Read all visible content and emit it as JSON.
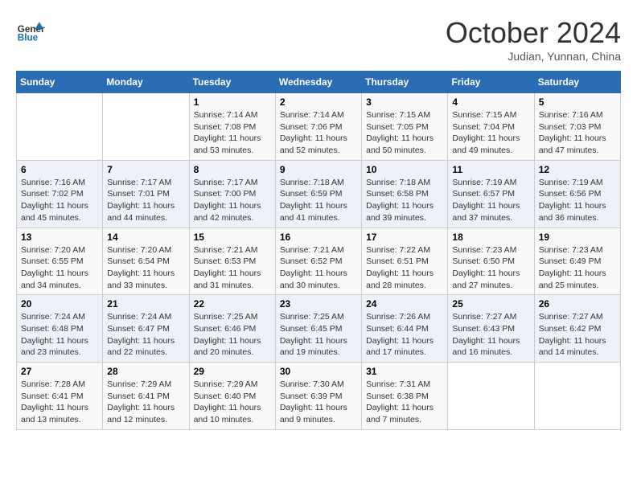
{
  "header": {
    "logo_general": "General",
    "logo_blue": "Blue",
    "month_title": "October 2024",
    "subtitle": "Judian, Yunnan, China"
  },
  "days_of_week": [
    "Sunday",
    "Monday",
    "Tuesday",
    "Wednesday",
    "Thursday",
    "Friday",
    "Saturday"
  ],
  "weeks": [
    [
      {
        "day": "",
        "sunrise": "",
        "sunset": "",
        "daylight": ""
      },
      {
        "day": "",
        "sunrise": "",
        "sunset": "",
        "daylight": ""
      },
      {
        "day": "1",
        "sunrise": "Sunrise: 7:14 AM",
        "sunset": "Sunset: 7:08 PM",
        "daylight": "Daylight: 11 hours and 53 minutes."
      },
      {
        "day": "2",
        "sunrise": "Sunrise: 7:14 AM",
        "sunset": "Sunset: 7:06 PM",
        "daylight": "Daylight: 11 hours and 52 minutes."
      },
      {
        "day": "3",
        "sunrise": "Sunrise: 7:15 AM",
        "sunset": "Sunset: 7:05 PM",
        "daylight": "Daylight: 11 hours and 50 minutes."
      },
      {
        "day": "4",
        "sunrise": "Sunrise: 7:15 AM",
        "sunset": "Sunset: 7:04 PM",
        "daylight": "Daylight: 11 hours and 49 minutes."
      },
      {
        "day": "5",
        "sunrise": "Sunrise: 7:16 AM",
        "sunset": "Sunset: 7:03 PM",
        "daylight": "Daylight: 11 hours and 47 minutes."
      }
    ],
    [
      {
        "day": "6",
        "sunrise": "Sunrise: 7:16 AM",
        "sunset": "Sunset: 7:02 PM",
        "daylight": "Daylight: 11 hours and 45 minutes."
      },
      {
        "day": "7",
        "sunrise": "Sunrise: 7:17 AM",
        "sunset": "Sunset: 7:01 PM",
        "daylight": "Daylight: 11 hours and 44 minutes."
      },
      {
        "day": "8",
        "sunrise": "Sunrise: 7:17 AM",
        "sunset": "Sunset: 7:00 PM",
        "daylight": "Daylight: 11 hours and 42 minutes."
      },
      {
        "day": "9",
        "sunrise": "Sunrise: 7:18 AM",
        "sunset": "Sunset: 6:59 PM",
        "daylight": "Daylight: 11 hours and 41 minutes."
      },
      {
        "day": "10",
        "sunrise": "Sunrise: 7:18 AM",
        "sunset": "Sunset: 6:58 PM",
        "daylight": "Daylight: 11 hours and 39 minutes."
      },
      {
        "day": "11",
        "sunrise": "Sunrise: 7:19 AM",
        "sunset": "Sunset: 6:57 PM",
        "daylight": "Daylight: 11 hours and 37 minutes."
      },
      {
        "day": "12",
        "sunrise": "Sunrise: 7:19 AM",
        "sunset": "Sunset: 6:56 PM",
        "daylight": "Daylight: 11 hours and 36 minutes."
      }
    ],
    [
      {
        "day": "13",
        "sunrise": "Sunrise: 7:20 AM",
        "sunset": "Sunset: 6:55 PM",
        "daylight": "Daylight: 11 hours and 34 minutes."
      },
      {
        "day": "14",
        "sunrise": "Sunrise: 7:20 AM",
        "sunset": "Sunset: 6:54 PM",
        "daylight": "Daylight: 11 hours and 33 minutes."
      },
      {
        "day": "15",
        "sunrise": "Sunrise: 7:21 AM",
        "sunset": "Sunset: 6:53 PM",
        "daylight": "Daylight: 11 hours and 31 minutes."
      },
      {
        "day": "16",
        "sunrise": "Sunrise: 7:21 AM",
        "sunset": "Sunset: 6:52 PM",
        "daylight": "Daylight: 11 hours and 30 minutes."
      },
      {
        "day": "17",
        "sunrise": "Sunrise: 7:22 AM",
        "sunset": "Sunset: 6:51 PM",
        "daylight": "Daylight: 11 hours and 28 minutes."
      },
      {
        "day": "18",
        "sunrise": "Sunrise: 7:23 AM",
        "sunset": "Sunset: 6:50 PM",
        "daylight": "Daylight: 11 hours and 27 minutes."
      },
      {
        "day": "19",
        "sunrise": "Sunrise: 7:23 AM",
        "sunset": "Sunset: 6:49 PM",
        "daylight": "Daylight: 11 hours and 25 minutes."
      }
    ],
    [
      {
        "day": "20",
        "sunrise": "Sunrise: 7:24 AM",
        "sunset": "Sunset: 6:48 PM",
        "daylight": "Daylight: 11 hours and 23 minutes."
      },
      {
        "day": "21",
        "sunrise": "Sunrise: 7:24 AM",
        "sunset": "Sunset: 6:47 PM",
        "daylight": "Daylight: 11 hours and 22 minutes."
      },
      {
        "day": "22",
        "sunrise": "Sunrise: 7:25 AM",
        "sunset": "Sunset: 6:46 PM",
        "daylight": "Daylight: 11 hours and 20 minutes."
      },
      {
        "day": "23",
        "sunrise": "Sunrise: 7:25 AM",
        "sunset": "Sunset: 6:45 PM",
        "daylight": "Daylight: 11 hours and 19 minutes."
      },
      {
        "day": "24",
        "sunrise": "Sunrise: 7:26 AM",
        "sunset": "Sunset: 6:44 PM",
        "daylight": "Daylight: 11 hours and 17 minutes."
      },
      {
        "day": "25",
        "sunrise": "Sunrise: 7:27 AM",
        "sunset": "Sunset: 6:43 PM",
        "daylight": "Daylight: 11 hours and 16 minutes."
      },
      {
        "day": "26",
        "sunrise": "Sunrise: 7:27 AM",
        "sunset": "Sunset: 6:42 PM",
        "daylight": "Daylight: 11 hours and 14 minutes."
      }
    ],
    [
      {
        "day": "27",
        "sunrise": "Sunrise: 7:28 AM",
        "sunset": "Sunset: 6:41 PM",
        "daylight": "Daylight: 11 hours and 13 minutes."
      },
      {
        "day": "28",
        "sunrise": "Sunrise: 7:29 AM",
        "sunset": "Sunset: 6:41 PM",
        "daylight": "Daylight: 11 hours and 12 minutes."
      },
      {
        "day": "29",
        "sunrise": "Sunrise: 7:29 AM",
        "sunset": "Sunset: 6:40 PM",
        "daylight": "Daylight: 11 hours and 10 minutes."
      },
      {
        "day": "30",
        "sunrise": "Sunrise: 7:30 AM",
        "sunset": "Sunset: 6:39 PM",
        "daylight": "Daylight: 11 hours and 9 minutes."
      },
      {
        "day": "31",
        "sunrise": "Sunrise: 7:31 AM",
        "sunset": "Sunset: 6:38 PM",
        "daylight": "Daylight: 11 hours and 7 minutes."
      },
      {
        "day": "",
        "sunrise": "",
        "sunset": "",
        "daylight": ""
      },
      {
        "day": "",
        "sunrise": "",
        "sunset": "",
        "daylight": ""
      }
    ]
  ]
}
